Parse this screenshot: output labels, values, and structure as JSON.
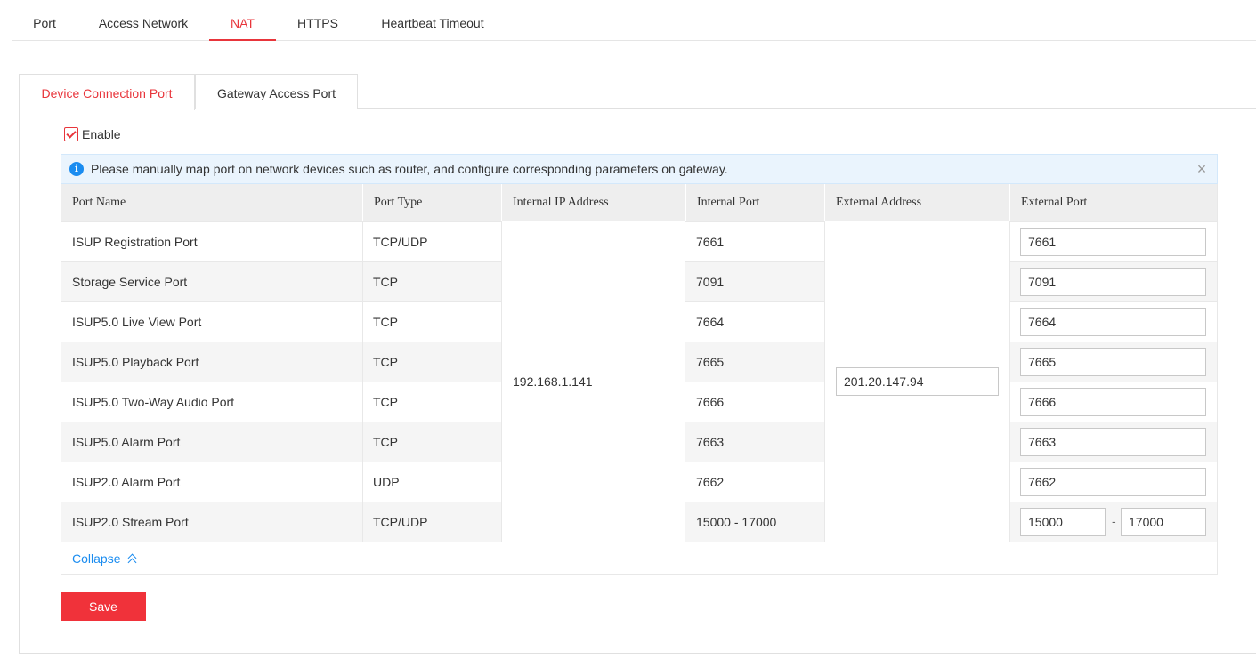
{
  "top_tabs": [
    {
      "label": "Port"
    },
    {
      "label": "Access Network"
    },
    {
      "label": "NAT",
      "active": true
    },
    {
      "label": "HTTPS"
    },
    {
      "label": "Heartbeat Timeout"
    }
  ],
  "sub_tabs": [
    {
      "label": "Device Connection Port",
      "active": true
    },
    {
      "label": "Gateway Access Port"
    }
  ],
  "enable": {
    "label": "Enable",
    "checked": true
  },
  "info": {
    "text": "Please manually map port on network devices such as router, and configure corresponding parameters on gateway.",
    "icon": "info-icon",
    "close_icon": "close-icon"
  },
  "table": {
    "headers": [
      "Port Name",
      "Port Type",
      "Internal IP Address",
      "Internal Port",
      "External Address",
      "External Port"
    ],
    "internal_ip": "192.168.1.141",
    "external_address": "201.20.147.94",
    "rows": [
      {
        "name": "ISUP Registration Port",
        "type": "TCP/UDP",
        "internal_port": "7661",
        "external_port": "7661"
      },
      {
        "name": "Storage Service Port",
        "type": "TCP",
        "internal_port": "7091",
        "external_port": "7091"
      },
      {
        "name": "ISUP5.0 Live View Port",
        "type": "TCP",
        "internal_port": "7664",
        "external_port": "7664"
      },
      {
        "name": "ISUP5.0 Playback Port",
        "type": "TCP",
        "internal_port": "7665",
        "external_port": "7665"
      },
      {
        "name": "ISUP5.0 Two-Way Audio Port",
        "type": "TCP",
        "internal_port": "7666",
        "external_port": "7666"
      },
      {
        "name": "ISUP5.0 Alarm Port",
        "type": "TCP",
        "internal_port": "7663",
        "external_port": "7663"
      },
      {
        "name": "ISUP2.0 Alarm Port",
        "type": "UDP",
        "internal_port": "7662",
        "external_port": "7662"
      },
      {
        "name": "ISUP2.0 Stream Port",
        "type": "TCP/UDP",
        "internal_port": "15000  - 17000",
        "external_port_start": "15000",
        "external_port_end": "17000",
        "range_separator": "-"
      }
    ]
  },
  "collapse": {
    "label": "Collapse",
    "icon": "chevron-up-double-icon"
  },
  "save": {
    "label": "Save"
  },
  "colors": {
    "accent": "#e8353b",
    "link": "#1a8cf0",
    "info_bg": "#eaf4fd"
  }
}
